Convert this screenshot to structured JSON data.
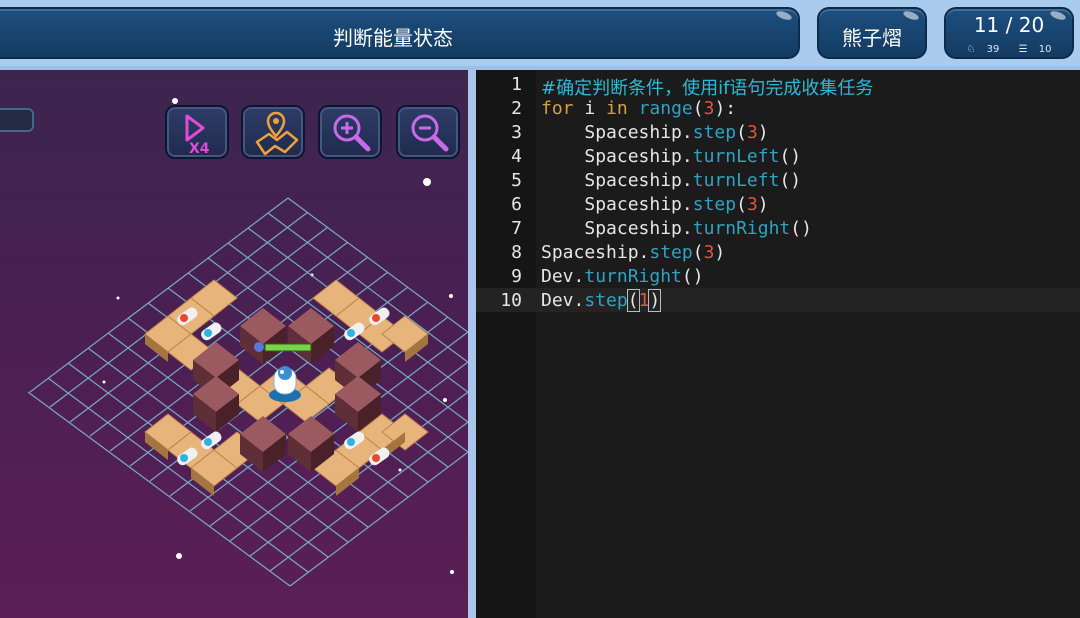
{
  "header": {
    "title": "判断能量状态",
    "user_name": "熊子熠",
    "level": "11 / 20",
    "stat_likes": "39",
    "stat_lines": "10"
  },
  "toolbar": {
    "speed_icon": "play-x4-icon",
    "speed_label": "X4",
    "map_icon": "map-location-icon",
    "zoom_in_icon": "zoom-in-icon",
    "zoom_out_icon": "zoom-out-icon"
  },
  "editor": {
    "lines": [
      {
        "no": "1",
        "comment": "#确定判断条件，使用if语句完成收集任务"
      },
      {
        "no": "2",
        "kw1": "for",
        "mid1": " i ",
        "kw2": "in",
        "mid2": " ",
        "fn": "range",
        "open": "(",
        "num": "3",
        "close": "):"
      },
      {
        "no": "3",
        "indent": "    ",
        "obj": "Spaceship.",
        "fn": "step",
        "open": "(",
        "num": "3",
        "close": ")"
      },
      {
        "no": "4",
        "indent": "    ",
        "obj": "Spaceship.",
        "fn": "turnLeft",
        "open": "()",
        "num": "",
        "close": ""
      },
      {
        "no": "5",
        "indent": "    ",
        "obj": "Spaceship.",
        "fn": "turnLeft",
        "open": "()",
        "num": "",
        "close": ""
      },
      {
        "no": "6",
        "indent": "    ",
        "obj": "Spaceship.",
        "fn": "step",
        "open": "(",
        "num": "3",
        "close": ")"
      },
      {
        "no": "7",
        "indent": "    ",
        "obj": "Spaceship.",
        "fn": "turnRight",
        "open": "()",
        "num": "",
        "close": ""
      },
      {
        "no": "8",
        "indent": "",
        "obj": "Spaceship.",
        "fn": "step",
        "open": "(",
        "num": "3",
        "close": ")"
      },
      {
        "no": "9",
        "indent": "",
        "obj": "Dev.",
        "fn": "turnRight",
        "open": "()",
        "num": "",
        "close": ""
      },
      {
        "no": "10",
        "indent": "",
        "obj": "Dev.",
        "fn": "step",
        "open": "(",
        "num": "1",
        "close": ")"
      }
    ]
  },
  "colors": {
    "header_blue": "#1d4f7f",
    "comment": "#2fb9d8",
    "keyword": "#d4a23c",
    "function": "#2ea3c2",
    "number": "#e0553d"
  }
}
